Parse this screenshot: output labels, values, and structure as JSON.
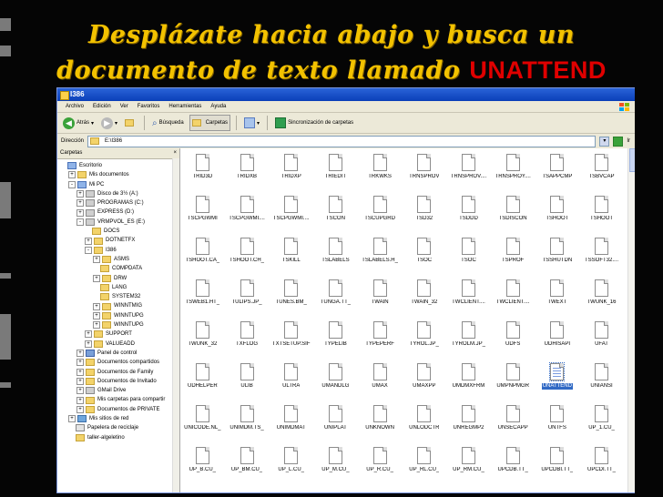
{
  "slide": {
    "title_line1": "Desplázate hacia abajo y busca un",
    "title_line2": "documento de texto llamado",
    "highlight": "UNATTEND",
    "title_color": "#f3c200",
    "highlight_color": "#e00000"
  },
  "window": {
    "title": "I386",
    "menu": [
      "Archivo",
      "Edición",
      "Ver",
      "Favoritos",
      "Herramientas",
      "Ayuda"
    ],
    "toolbar": {
      "back_label": "Atrás",
      "search_label": "Búsqueda",
      "folders_label": "Carpetas",
      "sync_label": "Sincronización de carpetas"
    },
    "address": {
      "label": "Dirección",
      "value": "E:\\I386",
      "go_label": "Ir"
    }
  },
  "tree": {
    "header": "Carpetas",
    "close": "×",
    "rows": [
      {
        "label": "Escritorio",
        "icon": "desktop-icon",
        "level": 0,
        "pm": ""
      },
      {
        "label": "Mis documentos",
        "icon": "folder-icon",
        "level": 1,
        "pm": "+"
      },
      {
        "label": "Mi PC",
        "icon": "computer-icon",
        "level": 1,
        "pm": "-"
      },
      {
        "label": "Disco de 3½ (A:)",
        "icon": "drive-icon",
        "level": 2,
        "pm": "+"
      },
      {
        "label": "PROGRAMAS (C:)",
        "icon": "drive-icon",
        "level": 2,
        "pm": "+"
      },
      {
        "label": "EXPRESS (D:)",
        "icon": "drive-icon",
        "level": 2,
        "pm": "+"
      },
      {
        "label": "VRMPVOL_ES (E:)",
        "icon": "drive-icon",
        "level": 2,
        "pm": "-"
      },
      {
        "label": "DOCS",
        "icon": "folder-icon",
        "level": 3,
        "pm": ""
      },
      {
        "label": "DOTNETFX",
        "icon": "folder-icon",
        "level": 3,
        "pm": "+"
      },
      {
        "label": "I386",
        "icon": "folder-icon",
        "level": 3,
        "pm": "-"
      },
      {
        "label": "ASMS",
        "icon": "folder-icon",
        "level": 4,
        "pm": "+"
      },
      {
        "label": "COMPDATA",
        "icon": "folder-icon",
        "level": 4,
        "pm": ""
      },
      {
        "label": "DRW",
        "icon": "folder-icon",
        "level": 4,
        "pm": "+"
      },
      {
        "label": "LANG",
        "icon": "folder-icon",
        "level": 4,
        "pm": ""
      },
      {
        "label": "SYSTEM32",
        "icon": "folder-icon",
        "level": 4,
        "pm": ""
      },
      {
        "label": "WINNTMIG",
        "icon": "folder-icon",
        "level": 4,
        "pm": "+"
      },
      {
        "label": "WINNTUPG",
        "icon": "folder-icon",
        "level": 4,
        "pm": "+"
      },
      {
        "label": "WINNTUPG",
        "icon": "folder-icon",
        "level": 4,
        "pm": "+"
      },
      {
        "label": "SUPPORT",
        "icon": "folder-icon",
        "level": 3,
        "pm": "+"
      },
      {
        "label": "VALUEADD",
        "icon": "folder-icon",
        "level": 3,
        "pm": "+"
      },
      {
        "label": "Panel de control",
        "icon": "control-panel-icon",
        "level": 2,
        "pm": "+"
      },
      {
        "label": "Documentos compartidos",
        "icon": "folder-icon",
        "level": 2,
        "pm": "+"
      },
      {
        "label": "Documentos de Family",
        "icon": "folder-icon",
        "level": 2,
        "pm": "+"
      },
      {
        "label": "Documentos de Invitado",
        "icon": "folder-icon",
        "level": 2,
        "pm": "+"
      },
      {
        "label": "GMail Drive",
        "icon": "drive-icon",
        "level": 2,
        "pm": "+"
      },
      {
        "label": "Mis carpetas para compartir",
        "icon": "folder-icon",
        "level": 2,
        "pm": "+"
      },
      {
        "label": "Documentos de PRIVATE",
        "icon": "folder-icon",
        "level": 2,
        "pm": "+"
      },
      {
        "label": "Mis sitios de red",
        "icon": "network-icon",
        "level": 1,
        "pm": "+"
      },
      {
        "label": "Papelera de reciclaje",
        "icon": "recycle-bin-icon",
        "level": 1,
        "pm": ""
      },
      {
        "label": "taller-algeletino",
        "icon": "folder-icon",
        "level": 1,
        "pm": ""
      }
    ]
  },
  "files": [
    "TRID3D",
    "TRIDXB",
    "TRIDXP",
    "TRIEDIT",
    "TRKWKS",
    "TRNSPROV",
    "TRNSPROV....",
    "TRNSPROY....",
    "TSAPPCMP",
    "TSBVCAP",
    "TSCPGWMI",
    "TSCPGWMI....",
    "TSCPGWMI....",
    "TSCON",
    "TSCUPGRD",
    "TSD32",
    "TSDDD",
    "TSDISCON",
    "TSHOOT",
    "TSHOOT",
    "TSHOOT.CA_",
    "TSHOOT.CH_",
    "TSKILL",
    "TSLABELS",
    "TSLABELS.H_",
    "TSOC",
    "TSOC",
    "TSPROF",
    "TSSHUTDN",
    "TSSOFT32....",
    "TSWEB1.HT_",
    "TULIPS.JP_",
    "TUNES.BM_",
    "TUNGA.TT_",
    "TWAIN",
    "TWAIN_32",
    "TWCLIENT....",
    "TWCLIENT....",
    "TWEXT",
    "TWUNK_16",
    "TWUNK_32",
    "TXFLOG",
    "TXTSETUP.SIF",
    "TYPELIB",
    "TYPEPERF",
    "TYROL.JP_",
    "TYROLM.JP_",
    "UDFS",
    "UDHISAPI",
    "UFAT",
    "UDHELPER",
    "ULIB",
    "ULTRA",
    "UMANDLG",
    "UMAX",
    "UMAXPP",
    "UMDMXFRM",
    "UMPNPMGR",
    "UNATTEND",
    "UNIANSI",
    "UNICODE.NL_",
    "UNIMDM.TS_",
    "UNIMDMAT",
    "UNIPLAT",
    "UNKNOWN",
    "UNLODCTR",
    "UNREGMP2",
    "UNSECAPP",
    "UNTFS",
    "UP_1.CU_",
    "UP_B.CU_",
    "UP_BM.CU_",
    "UP_L.CU_",
    "UP_M.CU_",
    "UP_R.CU_",
    "UP_RL.CU_",
    "UP_RM.CU_",
    "UPCDB.TT_",
    "UPCDBI.TT_",
    "UPCDI.TT_"
  ],
  "selected_file": "UNATTEND"
}
